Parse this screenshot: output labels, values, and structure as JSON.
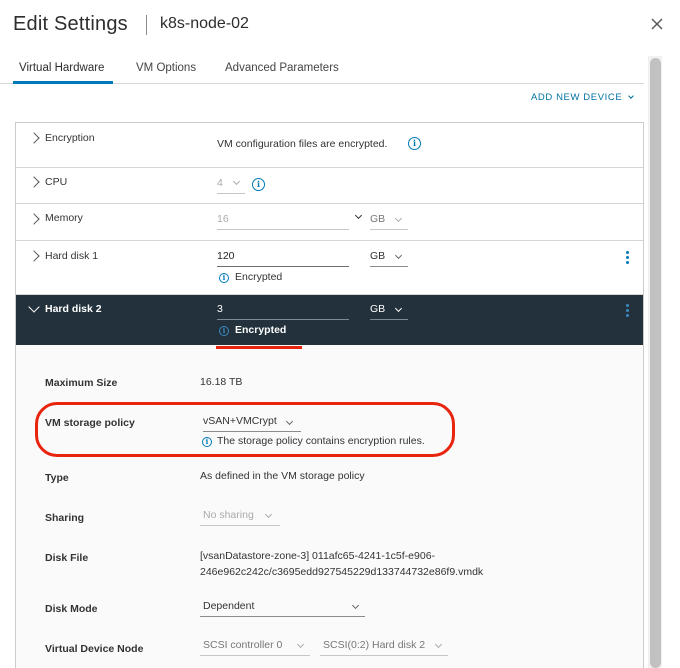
{
  "dialog": {
    "title": "Edit Settings",
    "vm_name": "k8s-node-02",
    "close_glyph": "✕"
  },
  "tabs": [
    {
      "label": "Virtual Hardware",
      "active": true
    },
    {
      "label": "VM Options",
      "active": false
    },
    {
      "label": "Advanced Parameters",
      "active": false
    }
  ],
  "add_device": {
    "label": "ADD NEW DEVICE"
  },
  "hardware": {
    "encryption": {
      "label": "Encryption",
      "value": "VM configuration files are encrypted."
    },
    "cpu": {
      "label": "CPU",
      "value": "4"
    },
    "memory": {
      "label": "Memory",
      "value": "16",
      "unit": "GB"
    },
    "hard_disk_1": {
      "label": "Hard disk 1",
      "size": "120",
      "unit": "GB",
      "status": "Encrypted"
    },
    "hard_disk_2": {
      "label": "Hard disk 2",
      "size": "3",
      "unit": "GB",
      "status": "Encrypted"
    }
  },
  "disk2_details": {
    "max_size": {
      "label": "Maximum Size",
      "value": "16.18 TB"
    },
    "storage_policy": {
      "label": "VM storage policy",
      "value": "vSAN+VMCrypt",
      "note": "The storage policy contains encryption rules."
    },
    "type": {
      "label": "Type",
      "value": "As defined in the VM storage policy"
    },
    "sharing": {
      "label": "Sharing",
      "value": "No sharing"
    },
    "disk_file": {
      "label": "Disk File",
      "line1": "[vsanDatastore-zone-3] 011afc65-4241-1c5f-e906-",
      "line2": "246e962c242c/c3695edd927545229d133744732e86f9.vmdk"
    },
    "disk_mode": {
      "label": "Disk Mode",
      "value": "Dependent"
    },
    "device_node": {
      "label": "Virtual Device Node",
      "controller": "SCSI controller 0",
      "slot": "SCSI(0:2) Hard disk 2"
    }
  },
  "icons": {
    "info": "i"
  },
  "colors": {
    "accent": "#0079b8",
    "highlight": "#e8240f",
    "selected_row": "#22313b"
  }
}
